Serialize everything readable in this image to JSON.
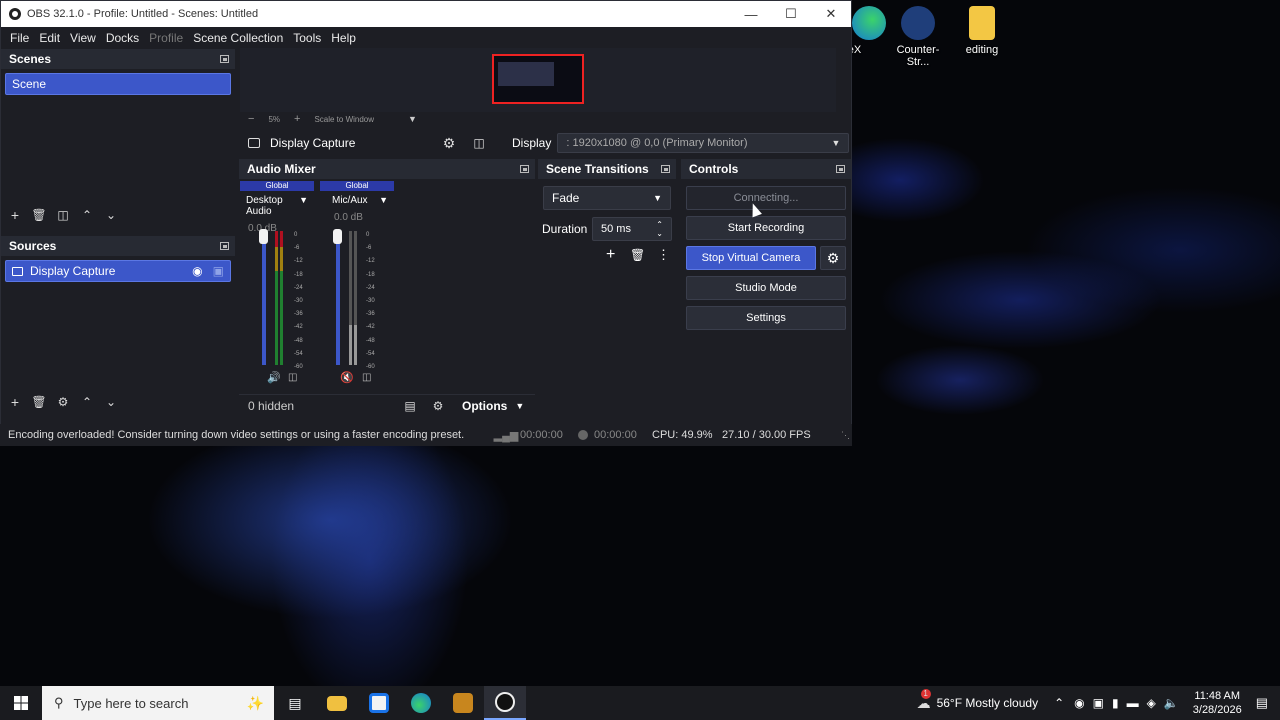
{
  "window": {
    "title": "OBS 32.1.0 - Profile: Untitled - Scenes: Untitled",
    "minimize_icon": "minimize-icon",
    "maximize_icon": "maximize-icon",
    "close_icon": "close-icon"
  },
  "menu": [
    "File",
    "Edit",
    "View",
    "Docks",
    "Profile",
    "Scene Collection",
    "Tools",
    "Help"
  ],
  "desktop_icons": [
    {
      "label": "areX",
      "color": "#27a03a"
    },
    {
      "label": "Counter-Str...",
      "color": "#2a5fb0"
    },
    {
      "label": "editing",
      "color": "#f0c040"
    }
  ],
  "scenes": {
    "title": "Scenes",
    "items": [
      "Scene"
    ]
  },
  "sources": {
    "title": "Sources",
    "items": [
      {
        "label": "Display Capture"
      }
    ]
  },
  "preview": {
    "zoom": "5%",
    "scale_mode": "Scale to Window"
  },
  "context_bar": {
    "source_name": "Display Capture",
    "display_label": "Display",
    "display_value": ": 1920x1080 @ 0,0 (Primary Monitor)"
  },
  "audio_mixer": {
    "title": "Audio Mixer",
    "channels": [
      {
        "scope": "Global",
        "name": "Desktop Audio",
        "db": "0.0 dB",
        "muted": false
      },
      {
        "scope": "Global",
        "name": "Mic/Aux",
        "db": "0.0 dB",
        "muted": true
      }
    ],
    "scale": [
      "0",
      "-6",
      "-12",
      "-18",
      "-24",
      "-30",
      "-36",
      "-42",
      "-48",
      "-54",
      "-60"
    ],
    "hidden_label": "0 hidden",
    "options_label": "Options"
  },
  "transitions": {
    "title": "Scene Transitions",
    "selected": "Fade",
    "duration_label": "Duration",
    "duration_value": "50 ms"
  },
  "controls": {
    "title": "Controls",
    "stream_label": "Connecting...",
    "record_label": "Start Recording",
    "virtual_cam_label": "Stop Virtual Camera",
    "studio_label": "Studio Mode",
    "settings_label": "Settings"
  },
  "status": {
    "message": "Encoding overloaded! Consider turning down video settings or using a faster encoding preset.",
    "stream_time": "00:00:00",
    "record_time": "00:00:00",
    "cpu": "CPU: 49.9%",
    "fps": "27.10 / 30.00 FPS"
  },
  "taskbar": {
    "search_placeholder": "Type here to search",
    "weather": "56°F Mostly cloudy",
    "time": "11:48 AM",
    "date": "3/28/2026",
    "notification_badge": "1"
  },
  "colors": {
    "accent": "#3c57c9",
    "window_bg": "#1d1e24",
    "dock_header": "#272a33"
  }
}
